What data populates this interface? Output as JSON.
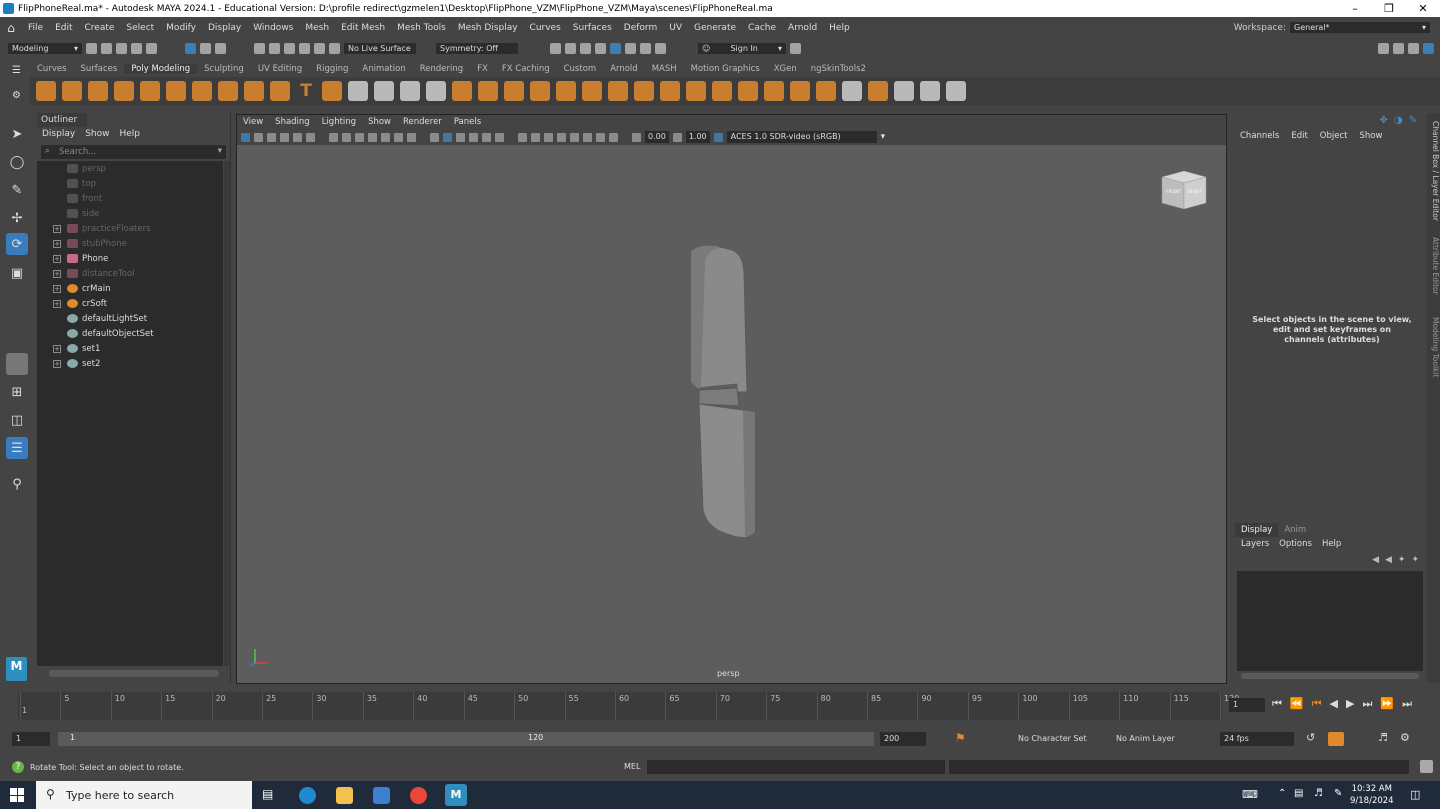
{
  "window": {
    "title": "FlipPhoneReal.ma* - Autodesk MAYA 2024.1 - Educational Version: D:\\profile redirect\\gzmelen1\\Desktop\\FlipPhone_VZM\\FlipPhone_VZM\\Maya\\scenes\\FlipPhoneReal.ma"
  },
  "menubar": {
    "items": [
      "File",
      "Edit",
      "Create",
      "Select",
      "Modify",
      "Display",
      "Windows",
      "Mesh",
      "Edit Mesh",
      "Mesh Tools",
      "Mesh Display",
      "Curves",
      "Surfaces",
      "Deform",
      "UV",
      "Generate",
      "Cache",
      "Arnold",
      "Help"
    ],
    "workspace_label": "Workspace:",
    "workspace_value": "General*"
  },
  "statusline": {
    "mode": "Modeling",
    "live_surface": "No Live Surface",
    "symmetry": "Symmetry: Off",
    "sign_in": "Sign In"
  },
  "shelf": {
    "tabs": [
      "Curves",
      "Surfaces",
      "Poly Modeling",
      "Sculpting",
      "UV Editing",
      "Rigging",
      "Animation",
      "Rendering",
      "FX",
      "FX Caching",
      "Custom",
      "Arnold",
      "MASH",
      "Motion Graphics",
      "XGen",
      "ngSkinTools2"
    ],
    "active_tab": "Poly Modeling"
  },
  "outliner": {
    "title": "Outliner",
    "menu": [
      "Display",
      "Show",
      "Help"
    ],
    "search_placeholder": "Search...",
    "items": [
      {
        "label": "persp",
        "dim": true,
        "expandable": false,
        "icon": "camera"
      },
      {
        "label": "top",
        "dim": true,
        "expandable": false,
        "icon": "camera"
      },
      {
        "label": "front",
        "dim": true,
        "expandable": false,
        "icon": "camera"
      },
      {
        "label": "side",
        "dim": true,
        "expandable": false,
        "icon": "camera"
      },
      {
        "label": "practiceFloaters",
        "dim": true,
        "expandable": true,
        "icon": "group"
      },
      {
        "label": "stubPhone",
        "dim": true,
        "expandable": true,
        "icon": "group"
      },
      {
        "label": "Phone",
        "dim": false,
        "expandable": true,
        "icon": "group"
      },
      {
        "label": "distanceTool",
        "dim": true,
        "expandable": true,
        "icon": "group"
      },
      {
        "label": "crMain",
        "dim": false,
        "expandable": true,
        "icon": "curve"
      },
      {
        "label": "crSoft",
        "dim": false,
        "expandable": true,
        "icon": "curve"
      },
      {
        "label": "defaultLightSet",
        "dim": false,
        "expandable": false,
        "icon": "set"
      },
      {
        "label": "defaultObjectSet",
        "dim": false,
        "expandable": false,
        "icon": "set"
      },
      {
        "label": "set1",
        "dim": false,
        "expandable": true,
        "icon": "set"
      },
      {
        "label": "set2",
        "dim": false,
        "expandable": true,
        "icon": "set"
      }
    ]
  },
  "viewport": {
    "menu": [
      "View",
      "Shading",
      "Lighting",
      "Show",
      "Renderer",
      "Panels"
    ],
    "exposure": "0.00",
    "gamma": "1.00",
    "colorspace": "ACES 1.0 SDR-video (sRGB)",
    "camera_label": "persp",
    "viewcube_front": "FRONT",
    "viewcube_right": "RIGHT"
  },
  "channelbox": {
    "menu": [
      "Channels",
      "Edit",
      "Object",
      "Show"
    ],
    "message": "Select objects in the scene to view, edit and set keyframes on channels (attributes)"
  },
  "sidetabs": [
    "Channel Box / Layer Editor",
    "Attribute Editor",
    "Modeling Toolkit"
  ],
  "layereditor": {
    "tabs": [
      "Display",
      "Anim"
    ],
    "menu": [
      "Layers",
      "Options",
      "Help"
    ]
  },
  "timeline": {
    "ticks": [
      "1",
      "5",
      "10",
      "15",
      "20",
      "25",
      "30",
      "35",
      "40",
      "45",
      "50",
      "55",
      "60",
      "65",
      "70",
      "75",
      "80",
      "85",
      "90",
      "95",
      "100",
      "105",
      "110",
      "115",
      "120"
    ],
    "current_frame": "1"
  },
  "range": {
    "start": "1",
    "inner_start": "1",
    "inner_end": "120",
    "end": "200",
    "character_set": "No Character Set",
    "anim_layer": "No Anim Layer",
    "fps": "24 fps"
  },
  "commandline": {
    "help_text": "Rotate Tool: Select an object to rotate.",
    "mel_label": "MEL"
  },
  "taskbar": {
    "search_placeholder": "Type here to search",
    "time": "10:32 AM",
    "date": "9/18/2024"
  }
}
